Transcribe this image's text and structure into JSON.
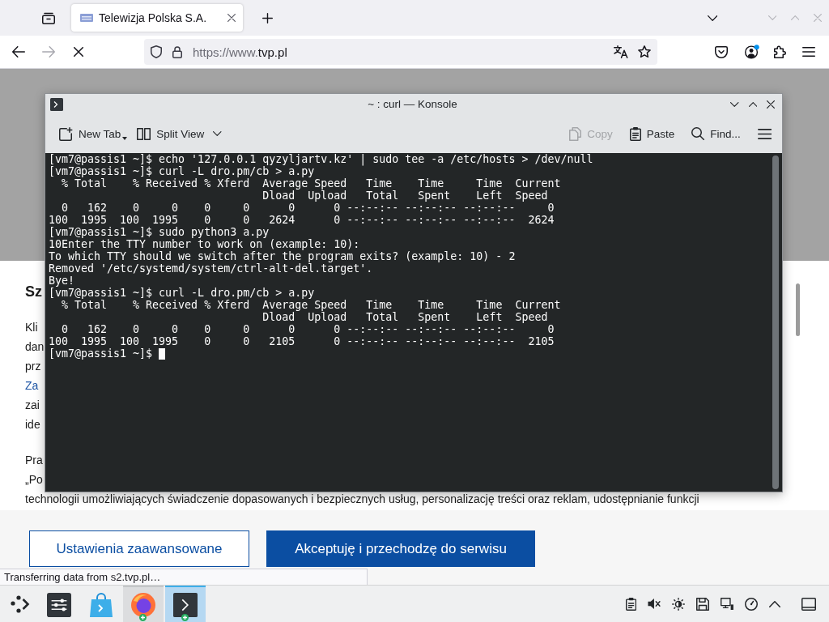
{
  "browser": {
    "tabs": [
      {
        "title": "Telewizja Polska S.A.",
        "selected": true
      }
    ],
    "nav_buttons": [
      {
        "kind": "back",
        "disabled": false
      },
      {
        "kind": "forward",
        "disabled": true
      },
      {
        "kind": "stop",
        "disabled": false
      }
    ],
    "address": {
      "url_start": "https://www.",
      "url_domain": "tvp.pl"
    },
    "status": "Transferring data from s2.tvp.pl…"
  },
  "page": {
    "heading": "Sz",
    "paragraphs": [
      [
        {
          "kind": "text",
          "text": "Kli"
        },
        {
          "kind": "text",
          "text": "dan"
        },
        {
          "kind": "text",
          "text": "prz"
        },
        {
          "kind": "link",
          "text": "Za"
        },
        {
          "kind": "text",
          "text": "zai"
        },
        {
          "kind": "text",
          "text": "ide"
        }
      ],
      [
        {
          "kind": "text",
          "text": "Pra"
        },
        {
          "kind": "text",
          "text": "„Po"
        },
        {
          "kind": "text",
          "text": "technologii umożliwiających świadczenie dopasowanych i bezpiecznych usług, personalizację treści oraz reklam, udostępnianie funkcji"
        }
      ]
    ],
    "buttons": [
      {
        "kind": "outline",
        "label": "Ustawienia zaawansowane"
      },
      {
        "kind": "primary",
        "label": "Akceptuję i przechodzę do serwisu"
      }
    ]
  },
  "konsole": {
    "title": "~ : curl — Konsole",
    "toolbar": {
      "left": [
        {
          "kind": "new-tab",
          "label": "New Tab",
          "disabled": false
        },
        {
          "kind": "split-view",
          "label": "Split View",
          "disabled": false
        }
      ],
      "right": [
        {
          "kind": "copy",
          "label": "Copy",
          "disabled": true
        },
        {
          "kind": "paste",
          "label": "Paste",
          "disabled": false
        },
        {
          "kind": "find",
          "label": "Find...",
          "disabled": false
        }
      ]
    },
    "terminal_lines": [
      "[vm7@passis1 ~]$ echo '127.0.0.1 qyzyljartv.kz' | sudo tee -a /etc/hosts > /dev/null",
      "[vm7@passis1 ~]$ curl -L dro.pm/cb > a.py",
      "  % Total    % Received % Xferd  Average Speed   Time    Time     Time  Current",
      "                                 Dload  Upload   Total   Spent    Left  Speed",
      "  0   162    0     0    0     0      0      0 --:--:-- --:--:-- --:--:--     0",
      "100  1995  100  1995    0     0   2624      0 --:--:-- --:--:-- --:--:--  2624",
      "[vm7@passis1 ~]$ sudo python3 a.py",
      "10Enter the TTY number to work on (example: 10):",
      "To which TTY should we switch after the program exits? (example: 10) - 2",
      "Removed '/etc/systemd/system/ctrl-alt-del.target'.",
      "Bye!",
      "[vm7@passis1 ~]$ curl -L dro.pm/cb > a.py",
      "  % Total    % Received % Xferd  Average Speed   Time    Time     Time  Current",
      "                                 Dload  Upload   Total   Spent    Left  Speed",
      "  0   162    0     0    0     0      0      0 --:--:-- --:--:-- --:--:--     0",
      "100  1995  100  1995    0     0   2105      0 --:--:-- --:--:-- --:--:--  2105",
      "[vm7@passis1 ~]$"
    ]
  },
  "taskbar": {
    "tasks": [
      {
        "kind": "settings",
        "open": false,
        "selected": false
      },
      {
        "kind": "store",
        "open": false,
        "selected": false
      },
      {
        "kind": "browser",
        "open": true,
        "selected": false
      },
      {
        "kind": "terminal",
        "open": true,
        "selected": true
      }
    ]
  }
}
